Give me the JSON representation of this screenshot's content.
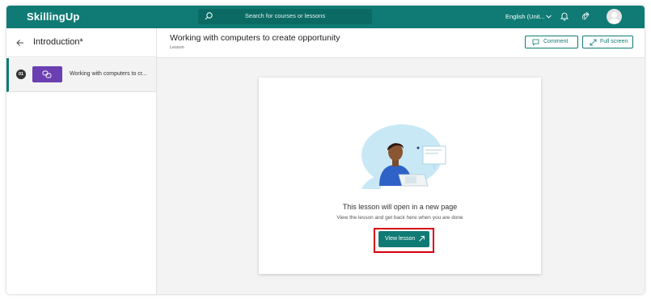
{
  "app": {
    "name": "SkillingUp"
  },
  "search": {
    "placeholder": "Search for courses or lessons"
  },
  "header": {
    "language": "English (Unit..."
  },
  "sidebar": {
    "title": "Introduction*",
    "items": [
      {
        "number": "01",
        "label": "Working with computers to cr..."
      }
    ]
  },
  "lesson": {
    "title": "Working with computers to create opportunity",
    "type": "Lesson",
    "comment_label": "Comment",
    "fullscreen_label": "Full screen"
  },
  "card": {
    "title": "This lesson will open in a new page",
    "subtitle": "View the lesson and get back here when you are done",
    "button_label": "View lesson"
  },
  "colors": {
    "brand": "#0f7b74",
    "thumb": "#6b3fb1",
    "highlight": "#d7000f"
  },
  "icons": [
    "search-icon",
    "chevron-down-icon",
    "bell-icon",
    "clap-icon",
    "avatar",
    "back-arrow-icon",
    "link-icon",
    "comment-icon",
    "fullscreen-icon",
    "external-link-icon"
  ]
}
